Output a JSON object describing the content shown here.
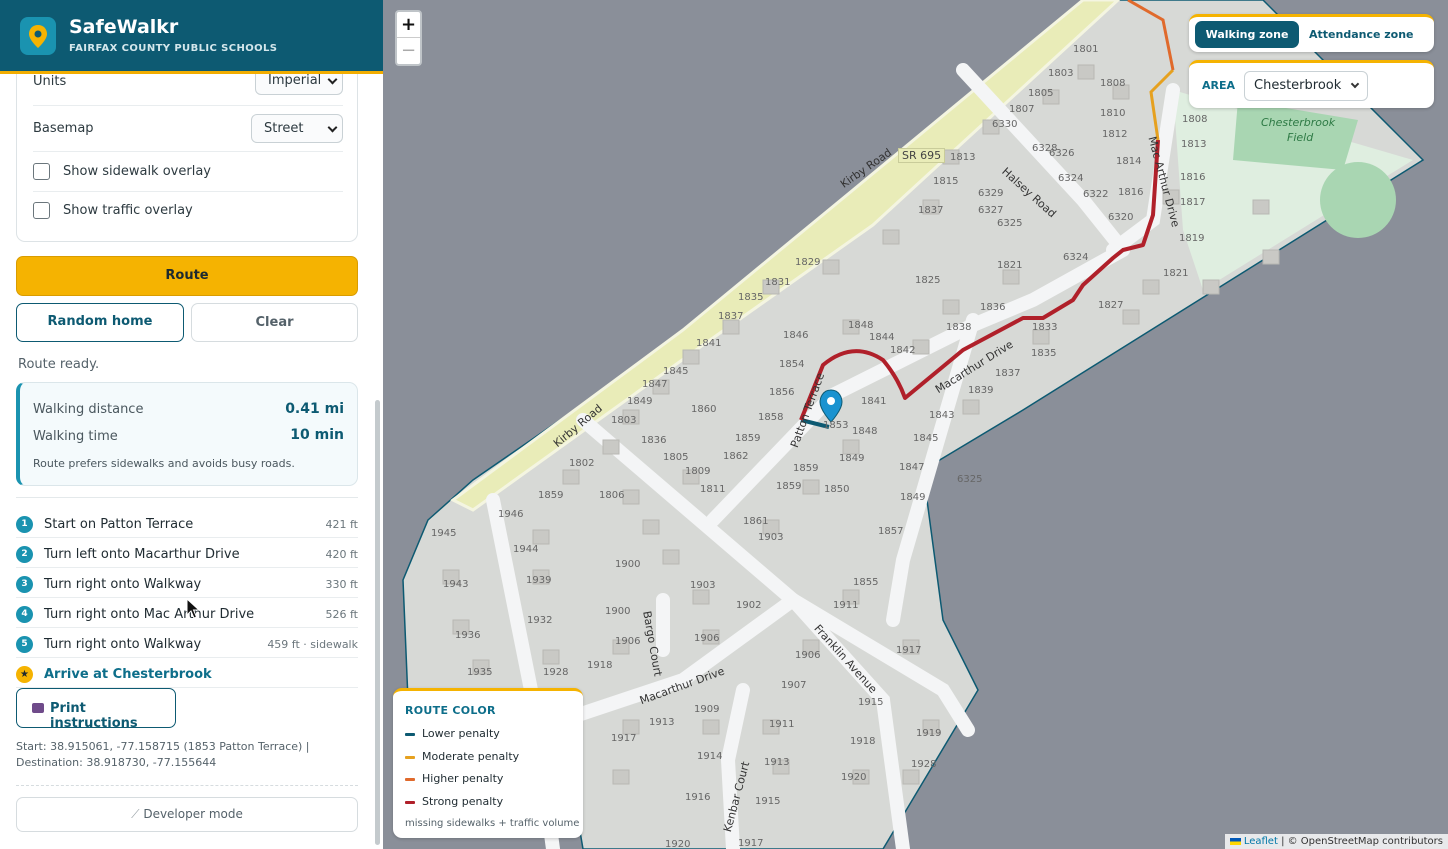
{
  "header": {
    "title": "SafeWalkr",
    "subtitle": "FAIRFAX COUNTY PUBLIC SCHOOLS"
  },
  "settings": {
    "units_label": "Units",
    "units_value": "Imperial",
    "basemap_label": "Basemap",
    "basemap_value": "Street",
    "sidewalk_overlay_label": "Show sidewalk overlay",
    "traffic_overlay_label": "Show traffic overlay"
  },
  "actions": {
    "route_label": "Route",
    "random_home_label": "Random home",
    "clear_label": "Clear"
  },
  "status": "Route ready.",
  "summary": {
    "distance_label": "Walking distance",
    "distance_value": "0.41 mi",
    "time_label": "Walking time",
    "time_value": "10 min",
    "note": "Route prefers sidewalks and avoids busy roads."
  },
  "steps": [
    {
      "num": "1",
      "text": "Start on Patton Terrace",
      "dist": "421 ft"
    },
    {
      "num": "2",
      "text": "Turn left onto Macarthur Drive",
      "dist": "420 ft"
    },
    {
      "num": "3",
      "text": "Turn right onto Walkway",
      "dist": "330 ft"
    },
    {
      "num": "4",
      "text": "Turn right onto Mac Arthur Drive",
      "dist": "526 ft"
    },
    {
      "num": "5",
      "text": "Turn right onto Walkway",
      "dist": "459 ft · sidewalk"
    }
  ],
  "arrive": "Arrive at Chesterbrook",
  "print_label": "Print instructions",
  "coords": {
    "start": "Start: 38.915061, -77.158715 (1853 Patton Terrace) |",
    "destination": "Destination: 38.918730, -77.155644"
  },
  "developer_label": "Developer mode",
  "map": {
    "zoom_in": "+",
    "zoom_out": "−",
    "zone_walking": "Walking zone",
    "zone_attendance": "Attendance zone",
    "area_label": "AREA",
    "area_value": "Chesterbrook",
    "field_label_1": "Chesterbrook",
    "field_label_2": "Field",
    "road_label_kirby_1": "Kirby Road",
    "road_label_kirby_2": "Kirby Road",
    "road_label_sr": "SR 695",
    "road_label_halsey": "Halsey Road",
    "road_label_macarthur_1": "Macarthur Drive",
    "road_label_macarthur_2": "Macarthur Drive",
    "road_label_mac_arthur": "Mac Arthur Drive",
    "road_label_patton": "Patton Terrace",
    "road_label_franklin": "Franklin Avenue",
    "road_label_bargo": "Bargo Court",
    "road_label_kenbar": "Kenbar Court",
    "house_numbers": [
      "1801",
      "1803",
      "1805",
      "1807",
      "1808",
      "1810",
      "1812",
      "1813",
      "1814",
      "1815",
      "1816",
      "1817",
      "1819",
      "1821",
      "1823",
      "1825",
      "1827",
      "1829",
      "1831",
      "1833",
      "1835",
      "1836",
      "1837",
      "1838",
      "1839",
      "1841",
      "1842",
      "1843",
      "1844",
      "1845",
      "1846",
      "1847",
      "1848",
      "1849",
      "1850",
      "1851",
      "1852",
      "1853",
      "1854",
      "1855",
      "1856",
      "1857",
      "1858",
      "1859",
      "1860",
      "1861",
      "1862",
      "1802",
      "1806",
      "1809",
      "1811",
      "1900",
      "1902",
      "1903",
      "1905",
      "1906",
      "1907",
      "1909",
      "1911",
      "1913",
      "1914",
      "1915",
      "1916",
      "1917",
      "1918",
      "1919",
      "1920",
      "1928",
      "1932",
      "1935",
      "1936",
      "1939",
      "1943",
      "1944",
      "1945",
      "1946",
      "6320",
      "6321",
      "6322",
      "6324",
      "6325",
      "6326",
      "6327",
      "6328",
      "6329",
      "6330"
    ],
    "legend": {
      "title": "ROUTE COLOR",
      "items": [
        {
          "label": "Lower penalty",
          "color": "#0d5a72"
        },
        {
          "label": "Moderate penalty",
          "color": "#e6a11f"
        },
        {
          "label": "Higher penalty",
          "color": "#e06a2c"
        },
        {
          "label": "Strong penalty",
          "color": "#b0202a"
        }
      ],
      "note": "missing sidewalks + traffic volume"
    },
    "attribution_leaflet": "Leaflet",
    "attribution_osm": "| © OpenStreetMap contributors"
  },
  "colors": {
    "brand": "#0d5a72",
    "accent": "#f5b301",
    "route_strong": "#b0202a"
  }
}
